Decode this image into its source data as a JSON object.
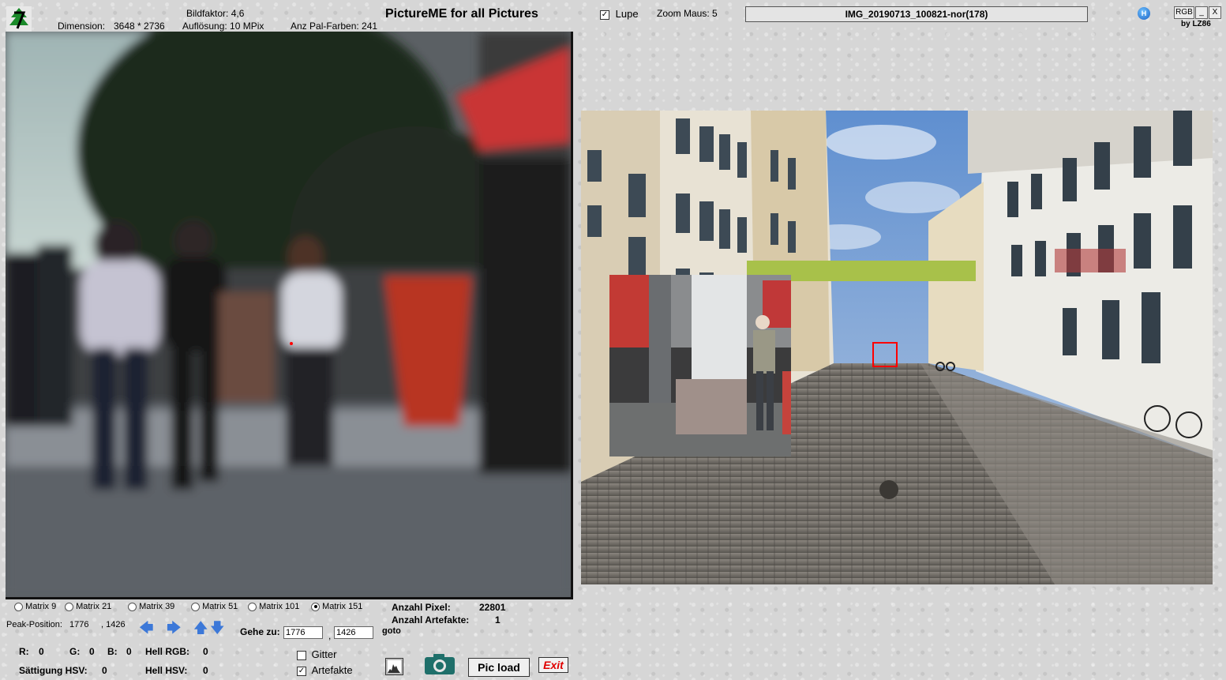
{
  "header": {
    "bildfaktor": "Bildfaktor: 4,6",
    "dimension_label": "Dimension:",
    "dimension_value": "3648 * 2736",
    "aufloesung": "Auflösung: 10 MPix",
    "pal_farben": "Anz Pal-Farben: 241",
    "title": "PictureME for all Pictures",
    "lupe_label": "Lupe",
    "lupe_checked": true,
    "zoom_maus": "Zoom Maus:  5",
    "filename": "IMG_20190713_100821-nor(178)",
    "h_button": "H",
    "rgb_button": "RGB",
    "minimize_button": "_",
    "close_button": "X",
    "by": "by LZ86"
  },
  "icons": {
    "logo": "tree-logo-icon",
    "help": "help-h-icon",
    "histogram": "histogram-icon",
    "camera": "camera-icon",
    "arrows": [
      "arrow-left-icon",
      "arrow-right-icon",
      "arrow-up-icon",
      "arrow-down-icon"
    ]
  },
  "matrix_options": [
    {
      "label": "Matrix 9",
      "selected": false
    },
    {
      "label": "Matrix 21",
      "selected": false
    },
    {
      "label": "Matrix 39",
      "selected": false
    },
    {
      "label": "Matrix 51",
      "selected": false
    },
    {
      "label": "Matrix 101",
      "selected": false
    },
    {
      "label": "Matrix 151",
      "selected": true
    }
  ],
  "stats": {
    "anzahl_pixel_label": "Anzahl Pixel:",
    "anzahl_pixel_value": "22801",
    "anzahl_artefakte_label": "Anzahl Artefakte:",
    "anzahl_artefakte_value": "1"
  },
  "peak": {
    "label": "Peak-Position:",
    "x": "1776",
    "y": ", 1426"
  },
  "goto": {
    "label": "Gehe zu:",
    "x_value": "1776",
    "comma": ",",
    "y_value": "1426",
    "button": "goto"
  },
  "color_info": {
    "r_label": "R:",
    "r_value": "0",
    "g_label": "G:",
    "g_value": "0",
    "b_label": "B:",
    "b_value": "0",
    "hell_rgb_label": "Hell RGB:",
    "hell_rgb_value": "0",
    "saettigung_label": "Sättigung HSV:",
    "saettigung_value": "0",
    "hell_hsv_label": "Hell HSV:",
    "hell_hsv_value": "0"
  },
  "options": {
    "gitter_label": "Gitter",
    "gitter_checked": false,
    "artefakte_label": "Artefakte",
    "artefakte_checked": true
  },
  "buttons": {
    "pic_load": "Pic load",
    "exit": "Exit"
  },
  "colors": {
    "exit_text": "#e00000",
    "arrow_blue": "#3c78d8",
    "marker_red": "#ff0000"
  }
}
